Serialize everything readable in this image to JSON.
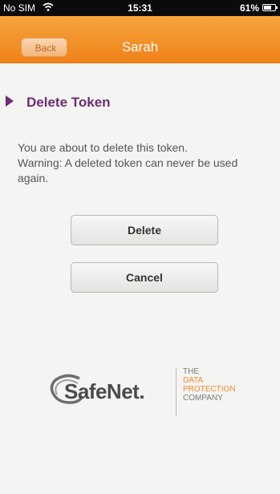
{
  "status_bar": {
    "carrier": "No SIM",
    "time": "15:31",
    "battery": "61%"
  },
  "nav": {
    "back_label": "Back",
    "title": "Sarah"
  },
  "section": {
    "title": "Delete Token"
  },
  "message": {
    "line1": "You are about to delete this token.",
    "line2": "Warning: A deleted token can never be used again."
  },
  "actions": {
    "delete_label": "Delete",
    "cancel_label": "Cancel"
  },
  "branding": {
    "logo_text": "SafeNet.",
    "tagline": [
      "THE",
      "DATA",
      "PROTECTION",
      "COMPANY"
    ]
  },
  "colors": {
    "nav_orange": "#f08218",
    "accent_purple": "#6b2e72",
    "tagline_orange": "#f08a2c"
  },
  "icons": {
    "wifi": "wifi-icon",
    "battery": "battery-icon",
    "back": "back-button",
    "section_marker": "triangle-marker-icon",
    "logo": "safenet-logo-icon"
  }
}
